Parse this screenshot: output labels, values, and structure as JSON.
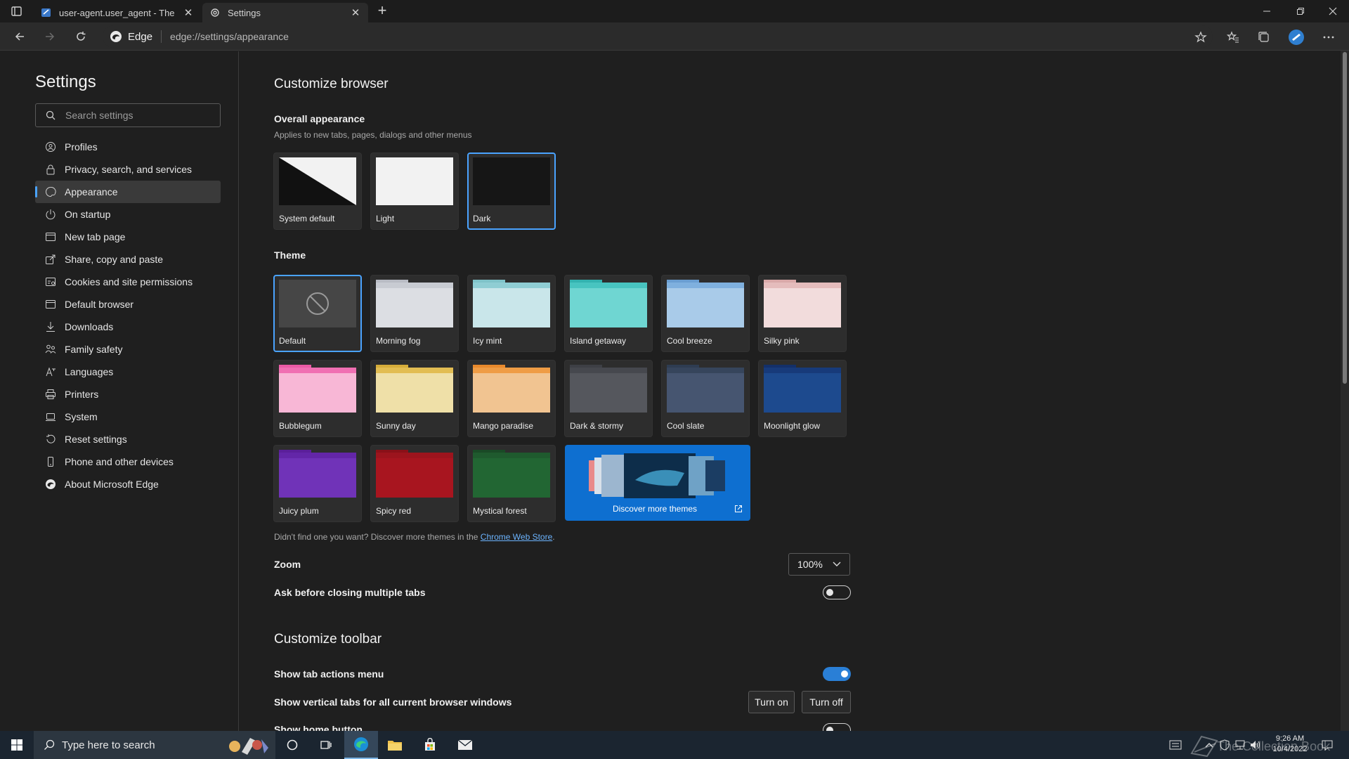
{
  "browser": {
    "tabs": [
      {
        "title": "user-agent.user_agent - The Colle"
      },
      {
        "title": "Settings"
      }
    ],
    "address": {
      "site": "Edge",
      "url": "edge://settings/appearance"
    }
  },
  "sidebar": {
    "title": "Settings",
    "search_placeholder": "Search settings",
    "items": [
      {
        "label": "Profiles",
        "icon": "profile-icon"
      },
      {
        "label": "Privacy, search, and services",
        "icon": "lock-icon"
      },
      {
        "label": "Appearance",
        "icon": "palette-icon",
        "active": true
      },
      {
        "label": "On startup",
        "icon": "power-icon"
      },
      {
        "label": "New tab page",
        "icon": "newtab-icon"
      },
      {
        "label": "Share, copy and paste",
        "icon": "share-icon"
      },
      {
        "label": "Cookies and site permissions",
        "icon": "cookie-icon"
      },
      {
        "label": "Default browser",
        "icon": "browser-icon"
      },
      {
        "label": "Downloads",
        "icon": "download-icon"
      },
      {
        "label": "Family safety",
        "icon": "family-icon"
      },
      {
        "label": "Languages",
        "icon": "language-icon"
      },
      {
        "label": "Printers",
        "icon": "printer-icon"
      },
      {
        "label": "System",
        "icon": "laptop-icon"
      },
      {
        "label": "Reset settings",
        "icon": "reset-icon"
      },
      {
        "label": "Phone and other devices",
        "icon": "phone-icon"
      },
      {
        "label": "About Microsoft Edge",
        "icon": "edge-icon"
      }
    ]
  },
  "main": {
    "title": "Customize browser",
    "appearance": {
      "heading": "Overall appearance",
      "subtitle": "Applies to new tabs, pages, dialogs and other menus",
      "options": [
        {
          "label": "System default"
        },
        {
          "label": "Light"
        },
        {
          "label": "Dark",
          "selected": true
        }
      ]
    },
    "theme": {
      "heading": "Theme",
      "options": [
        {
          "label": "Default",
          "selected": true
        },
        {
          "label": "Morning fog",
          "tab": "#b9bcc4",
          "top": "#c8cbd2",
          "body": "#dcdee3"
        },
        {
          "label": "Icy mint",
          "tab": "#7fc3c9",
          "top": "#8fcdd3",
          "body": "#c9e6ea"
        },
        {
          "label": "Island getaway",
          "tab": "#33b3b0",
          "top": "#48c4c0",
          "body": "#6fd6d2"
        },
        {
          "label": "Cool breeze",
          "tab": "#6a9ed2",
          "top": "#7fb0de",
          "body": "#a9cbe9"
        },
        {
          "label": "Silky pink",
          "tab": "#d9a9a9",
          "top": "#e4bcbc",
          "body": "#f2dcdc"
        },
        {
          "label": "Bubblegum",
          "tab": "#ea5aa5",
          "top": "#f06fb2",
          "body": "#f8b7d6"
        },
        {
          "label": "Sunny day",
          "tab": "#d6ad3a",
          "top": "#e2bd52",
          "body": "#efe0a8"
        },
        {
          "label": "Mango paradise",
          "tab": "#e8892c",
          "top": "#ef9c45",
          "body": "#f1c491"
        },
        {
          "label": "Dark & stormy",
          "tab": "#3d3f45",
          "top": "#46484e",
          "body": "#55575d"
        },
        {
          "label": "Cool slate",
          "tab": "#2e3c52",
          "top": "#36455c",
          "body": "#465570"
        },
        {
          "label": "Moonlight glow",
          "tab": "#13306a",
          "top": "#173a7a",
          "body": "#1d4a8e"
        },
        {
          "label": "Juicy plum",
          "tab": "#5a1f9a",
          "top": "#6326a8",
          "body": "#7033b8"
        },
        {
          "label": "Spicy red",
          "tab": "#8a1018",
          "top": "#9c141d",
          "body": "#a8151f"
        },
        {
          "label": "Mystical forest",
          "tab": "#1a4a26",
          "top": "#1f5a2e",
          "body": "#226633"
        }
      ],
      "discover_label": "Discover more themes",
      "note_prefix": "Didn't find one you want? Discover more themes in the",
      "note_link": "Chrome Web Store",
      "note_suffix": "."
    },
    "zoom": {
      "label": "Zoom",
      "value": "100%"
    },
    "ask_close": {
      "label": "Ask before closing multiple tabs",
      "on": false
    },
    "toolbar_section": {
      "title": "Customize toolbar",
      "tab_actions": {
        "label": "Show tab actions menu",
        "on": true
      },
      "vertical_tabs": {
        "label": "Show vertical tabs for all current browser windows",
        "turn_on": "Turn on",
        "turn_off": "Turn off"
      },
      "home_button": {
        "label": "Show home button",
        "on": false
      }
    }
  },
  "taskbar": {
    "search_placeholder": "Type here to search",
    "time": "9:26 AM",
    "date": "10/4/2022",
    "watermark": "The Collection Book"
  },
  "colors": {
    "accent": "#4aa3ff",
    "toggle_on": "#2a7fd6",
    "discover_bg": "#0e6fd0"
  }
}
